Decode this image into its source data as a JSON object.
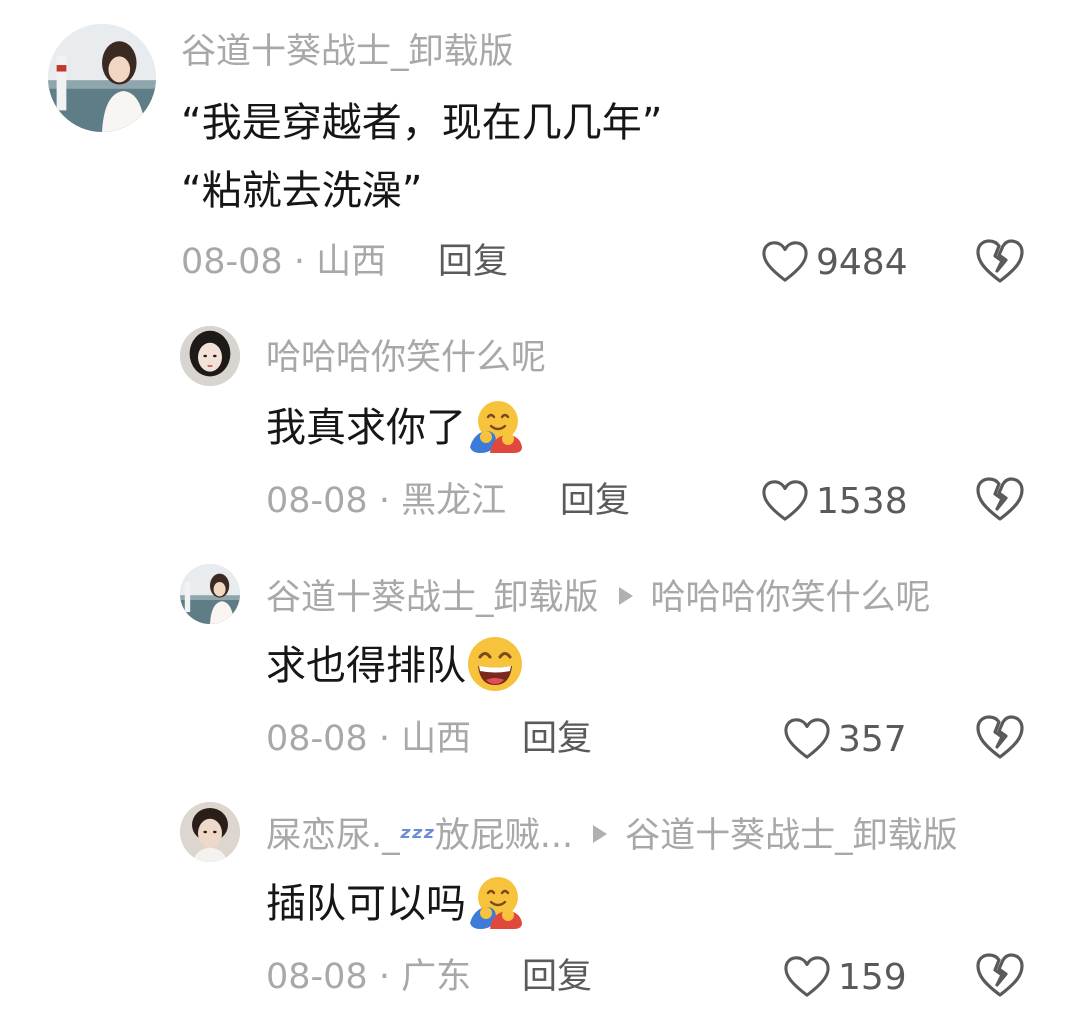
{
  "comments": [
    {
      "username": "谷道十葵战士_卸载版",
      "lines": [
        "“我是穿越者，现在几几年”",
        "“粘就去洗澡”"
      ],
      "date_location": "08-08 · 山西",
      "reply_label": "回复",
      "like_count": "9484",
      "like_icon": "heart-outline-icon",
      "dislike_icon": "broken-heart-icon"
    },
    {
      "username": "哈哈哈你笑什么呢",
      "text": "我真求你了",
      "emoji": "hugging-face-emoji",
      "date_location": "08-08 · 黑龙江",
      "reply_label": "回复",
      "like_count": "1538"
    },
    {
      "username": "谷道十葵战士_卸载版",
      "reply_to": "哈哈哈你笑什么呢",
      "text": "求也得排队",
      "emoji": "grinning-face-emoji",
      "date_location": "08-08 · 山西",
      "reply_label": "回复",
      "like_count": "357"
    },
    {
      "username_prefix": "屎恋尿._",
      "username_zz": "ᶻᶻᶻ",
      "username_suffix": "放屁贼...",
      "reply_to": "谷道十葵战士_卸载版",
      "text": "插队可以吗",
      "emoji": "hugging-face-emoji",
      "date_location": "08-08 · 广东",
      "reply_label": "回复",
      "like_count": "159"
    }
  ],
  "colors": {
    "muted_text": "#a8a8a8",
    "body_text": "#161616",
    "icon_gray": "#5a5a5a"
  }
}
